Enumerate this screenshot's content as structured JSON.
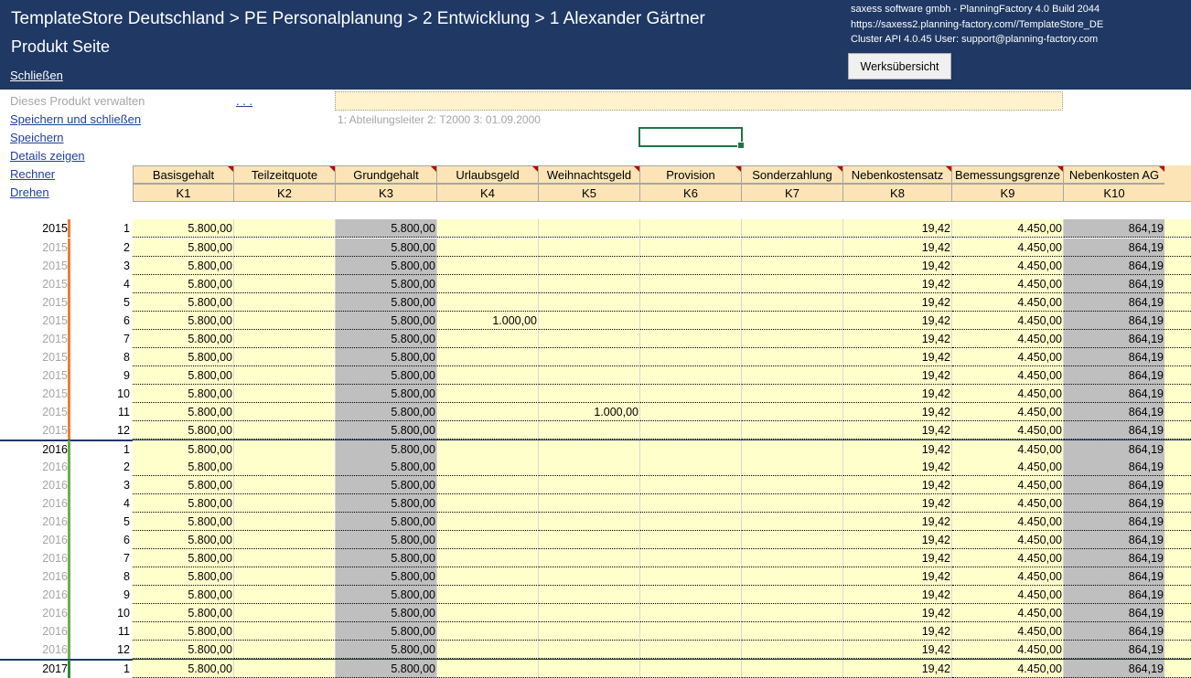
{
  "header": {
    "breadcrumb": "TemplateStore Deutschland > PE  Personalplanung > 2  Entwicklung > 1  Alexander Gärtner",
    "subtitle": "Produkt Seite",
    "close_label": "Schließen",
    "info_line1": "saxess software gmbh - PlanningFactory 4.0 Build 2044",
    "info_line2": "https://saxess2.planning-factory.com//TemplateStore_DE",
    "info_line3": "Cluster API 4.0.45  User: support@planning-factory.com",
    "overview_button": "Werksübersicht"
  },
  "menu": {
    "manage": "Dieses Produkt verwalten",
    "save_close": "Speichern und schließen",
    "save": "Speichern",
    "details": "Details zeigen",
    "calculator": "Rechner",
    "rotate": "Drehen",
    "dots": ". . ."
  },
  "product": {
    "name_value": "",
    "meta": "1: Abteilungsleiter   2: T2000   3: 01.09.2000"
  },
  "columns": [
    {
      "name": "Basisgehalt",
      "code": "K1"
    },
    {
      "name": "Teilzeitquote",
      "code": "K2"
    },
    {
      "name": "Grundgehalt",
      "code": "K3"
    },
    {
      "name": "Urlaubsgeld",
      "code": "K4"
    },
    {
      "name": "Weihnachtsgeld",
      "code": "K5"
    },
    {
      "name": "Provision",
      "code": "K6"
    },
    {
      "name": "Sonderzahlung",
      "code": "K7"
    },
    {
      "name": "Nebenkostensatz",
      "code": "K8"
    },
    {
      "name": "Bemessungsgrenze",
      "code": "K9"
    },
    {
      "name": "Nebenkosten AG",
      "code": "K10"
    }
  ],
  "rows": [
    {
      "year": "2015",
      "month": "1",
      "values": [
        "5.800,00",
        "",
        "5.800,00",
        "",
        "",
        "",
        "",
        "19,42",
        "4.450,00",
        "864,19"
      ]
    },
    {
      "year": "2015",
      "month": "2",
      "values": [
        "5.800,00",
        "",
        "5.800,00",
        "",
        "",
        "",
        "",
        "19,42",
        "4.450,00",
        "864,19"
      ]
    },
    {
      "year": "2015",
      "month": "3",
      "values": [
        "5.800,00",
        "",
        "5.800,00",
        "",
        "",
        "",
        "",
        "19,42",
        "4.450,00",
        "864,19"
      ]
    },
    {
      "year": "2015",
      "month": "4",
      "values": [
        "5.800,00",
        "",
        "5.800,00",
        "",
        "",
        "",
        "",
        "19,42",
        "4.450,00",
        "864,19"
      ]
    },
    {
      "year": "2015",
      "month": "5",
      "values": [
        "5.800,00",
        "",
        "5.800,00",
        "",
        "",
        "",
        "",
        "19,42",
        "4.450,00",
        "864,19"
      ]
    },
    {
      "year": "2015",
      "month": "6",
      "values": [
        "5.800,00",
        "",
        "5.800,00",
        "1.000,00",
        "",
        "",
        "",
        "19,42",
        "4.450,00",
        "864,19"
      ]
    },
    {
      "year": "2015",
      "month": "7",
      "values": [
        "5.800,00",
        "",
        "5.800,00",
        "",
        "",
        "",
        "",
        "19,42",
        "4.450,00",
        "864,19"
      ]
    },
    {
      "year": "2015",
      "month": "8",
      "values": [
        "5.800,00",
        "",
        "5.800,00",
        "",
        "",
        "",
        "",
        "19,42",
        "4.450,00",
        "864,19"
      ]
    },
    {
      "year": "2015",
      "month": "9",
      "values": [
        "5.800,00",
        "",
        "5.800,00",
        "",
        "",
        "",
        "",
        "19,42",
        "4.450,00",
        "864,19"
      ]
    },
    {
      "year": "2015",
      "month": "10",
      "values": [
        "5.800,00",
        "",
        "5.800,00",
        "",
        "",
        "",
        "",
        "19,42",
        "4.450,00",
        "864,19"
      ]
    },
    {
      "year": "2015",
      "month": "11",
      "values": [
        "5.800,00",
        "",
        "5.800,00",
        "",
        "1.000,00",
        "",
        "",
        "19,42",
        "4.450,00",
        "864,19"
      ]
    },
    {
      "year": "2015",
      "month": "12",
      "values": [
        "5.800,00",
        "",
        "5.800,00",
        "",
        "",
        "",
        "",
        "19,42",
        "4.450,00",
        "864,19"
      ]
    },
    {
      "year": "2016",
      "month": "1",
      "values": [
        "5.800,00",
        "",
        "5.800,00",
        "",
        "",
        "",
        "",
        "19,42",
        "4.450,00",
        "864,19"
      ]
    },
    {
      "year": "2016",
      "month": "2",
      "values": [
        "5.800,00",
        "",
        "5.800,00",
        "",
        "",
        "",
        "",
        "19,42",
        "4.450,00",
        "864,19"
      ]
    },
    {
      "year": "2016",
      "month": "3",
      "values": [
        "5.800,00",
        "",
        "5.800,00",
        "",
        "",
        "",
        "",
        "19,42",
        "4.450,00",
        "864,19"
      ]
    },
    {
      "year": "2016",
      "month": "4",
      "values": [
        "5.800,00",
        "",
        "5.800,00",
        "",
        "",
        "",
        "",
        "19,42",
        "4.450,00",
        "864,19"
      ]
    },
    {
      "year": "2016",
      "month": "5",
      "values": [
        "5.800,00",
        "",
        "5.800,00",
        "",
        "",
        "",
        "",
        "19,42",
        "4.450,00",
        "864,19"
      ]
    },
    {
      "year": "2016",
      "month": "6",
      "values": [
        "5.800,00",
        "",
        "5.800,00",
        "",
        "",
        "",
        "",
        "19,42",
        "4.450,00",
        "864,19"
      ]
    },
    {
      "year": "2016",
      "month": "7",
      "values": [
        "5.800,00",
        "",
        "5.800,00",
        "",
        "",
        "",
        "",
        "19,42",
        "4.450,00",
        "864,19"
      ]
    },
    {
      "year": "2016",
      "month": "8",
      "values": [
        "5.800,00",
        "",
        "5.800,00",
        "",
        "",
        "",
        "",
        "19,42",
        "4.450,00",
        "864,19"
      ]
    },
    {
      "year": "2016",
      "month": "9",
      "values": [
        "5.800,00",
        "",
        "5.800,00",
        "",
        "",
        "",
        "",
        "19,42",
        "4.450,00",
        "864,19"
      ]
    },
    {
      "year": "2016",
      "month": "10",
      "values": [
        "5.800,00",
        "",
        "5.800,00",
        "",
        "",
        "",
        "",
        "19,42",
        "4.450,00",
        "864,19"
      ]
    },
    {
      "year": "2016",
      "month": "11",
      "values": [
        "5.800,00",
        "",
        "5.800,00",
        "",
        "",
        "",
        "",
        "19,42",
        "4.450,00",
        "864,19"
      ]
    },
    {
      "year": "2016",
      "month": "12",
      "values": [
        "5.800,00",
        "",
        "5.800,00",
        "",
        "",
        "",
        "",
        "19,42",
        "4.450,00",
        "864,19"
      ]
    },
    {
      "year": "2017",
      "month": "1",
      "values": [
        "5.800,00",
        "",
        "5.800,00",
        "",
        "",
        "",
        "",
        "19,42",
        "4.450,00",
        "864,19"
      ]
    }
  ],
  "colors": {
    "banner": "#1f3864",
    "header_cell": "#fce4b6",
    "input_cell": "#ffffcc",
    "computed_cell": "#bfbfbf",
    "year_bar_2015": "#ed7d31",
    "year_bar_2016": "#70ad47",
    "year_bar_2017": "#2e8b3a",
    "link": "#1f3f9f"
  }
}
